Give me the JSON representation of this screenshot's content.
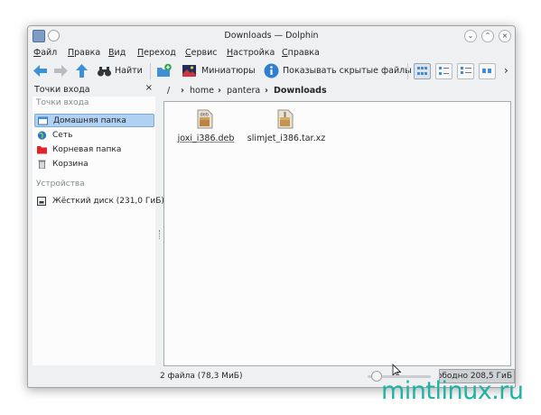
{
  "window": {
    "title": "Downloads — Dolphin"
  },
  "menu": [
    "Файл",
    "Правка",
    "Вид",
    "Переход",
    "Сервис",
    "Настройка",
    "Справка"
  ],
  "toolbar": {
    "find_label": "Найти",
    "previews_label": "Миниатюры",
    "hidden_label": "Показывать скрытые файлы",
    "more_label": "›"
  },
  "sidebar": {
    "panel_title": "Точки входа",
    "close_glyph": "×",
    "section_places": "Точки входа",
    "section_devices": "Устройства",
    "places": [
      {
        "label": "Домашняя папка",
        "icon": "home-icon"
      },
      {
        "label": "Сеть",
        "icon": "network-icon"
      },
      {
        "label": "Корневая папка",
        "icon": "root-folder-icon"
      },
      {
        "label": "Корзина",
        "icon": "trash-icon"
      }
    ],
    "devices": [
      {
        "label": "Жёсткий диск (231,0 ГиБ)",
        "icon": "harddisk-icon"
      }
    ]
  },
  "breadcrumb": {
    "root": "/",
    "parts": [
      "home",
      "pantera",
      "Downloads"
    ]
  },
  "files": [
    {
      "name": "joxi_i386.deb",
      "icon": "deb-package-icon",
      "badge": "deb"
    },
    {
      "name": "slimjet_i386.tar.xz",
      "icon": "archive-icon"
    }
  ],
  "status": {
    "text": "2 файла (78,3 МиБ)",
    "free_space": "Свободно 208,5 ГиБ"
  },
  "watermark": "mintlinux.ru",
  "colors": {
    "accent": "#3d8fd6",
    "selection": "#b0d1f1",
    "watermark": "#1fb3a5"
  }
}
